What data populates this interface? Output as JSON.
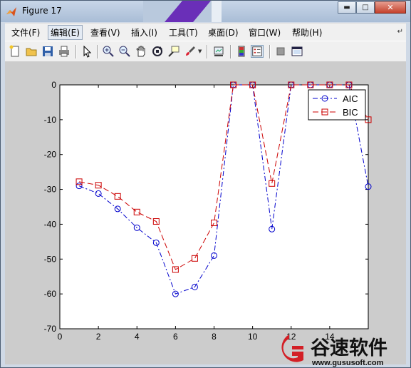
{
  "window": {
    "title": "Figure 17"
  },
  "menubar": {
    "items": [
      "文件(F)",
      "编辑(E)",
      "查看(V)",
      "插入(I)",
      "工具(T)",
      "桌面(D)",
      "窗口(W)",
      "帮助(H)"
    ],
    "active_index": 1
  },
  "toolbar": {
    "icons": [
      "new-figure-icon",
      "open-icon",
      "save-icon",
      "print-icon",
      "pointer-icon",
      "zoom-in-icon",
      "zoom-out-icon",
      "pan-icon",
      "rotate-icon",
      "data-cursor-icon",
      "brush-icon",
      "link-icon",
      "colorbar-icon",
      "legend-icon",
      "hide-plot-tools-icon",
      "show-plot-tools-icon"
    ]
  },
  "chart_data": {
    "type": "line",
    "xlim": [
      0,
      16
    ],
    "ylim": [
      -70,
      0
    ],
    "x_ticks": [
      "0",
      "2",
      "4",
      "6",
      "8",
      "10",
      "12",
      "14"
    ],
    "y_ticks": [
      "0",
      "-10",
      "-20",
      "-30",
      "-40",
      "-50",
      "-60",
      "-70"
    ],
    "x": [
      1,
      2,
      3,
      4,
      5,
      6,
      7,
      8,
      9,
      10,
      11,
      12,
      13,
      14,
      15,
      16
    ],
    "series": [
      {
        "name": "AIC",
        "color": "#0000cc",
        "marker": "circle",
        "line": "dash-dot",
        "values": [
          -29,
          -31.2,
          -35.6,
          -41,
          -45.3,
          -60,
          -58,
          -49,
          0,
          0,
          -41.4,
          0,
          0,
          0,
          0,
          -29.2
        ]
      },
      {
        "name": "BIC",
        "color": "#cc0000",
        "marker": "square",
        "line": "dashed",
        "values": [
          -27.8,
          -28.8,
          -32,
          -36.5,
          -39.2,
          -53,
          -49.8,
          -39.6,
          0,
          0,
          -28.3,
          0,
          0,
          0,
          0,
          -10
        ]
      }
    ],
    "legend_position": "top-right",
    "grid": false
  },
  "watermark": {
    "brand": "谷速软件",
    "url": "www.gususoft.com"
  }
}
